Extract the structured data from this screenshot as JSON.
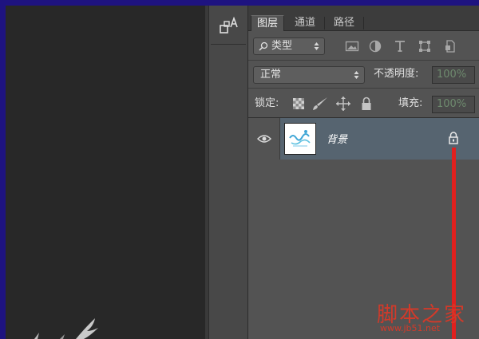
{
  "canvas": {},
  "toolstrip": {
    "icon": "character-panel-icon"
  },
  "panel": {
    "tabs": [
      {
        "label": "图层",
        "active": true
      },
      {
        "label": "通道",
        "active": false
      },
      {
        "label": "路径",
        "active": false
      }
    ],
    "filter": {
      "kind_label": "类型",
      "icons": [
        "image-filter-icon",
        "adjustment-filter-icon",
        "type-filter-icon",
        "shape-filter-icon",
        "smart-object-filter-icon"
      ]
    },
    "blend": {
      "mode": "正常",
      "opacity_label": "不透明度:",
      "opacity_value": "100%"
    },
    "lock": {
      "lock_label": "锁定:",
      "fill_label": "填充:",
      "fill_value": "100%"
    },
    "layers": [
      {
        "name": "背景",
        "visible": true,
        "locked": true
      }
    ]
  },
  "watermark": {
    "title": "脚本之家",
    "url": "www.jb51.net"
  },
  "colors": {
    "desktop_bg": "#1e1380",
    "panel_bg": "#535353",
    "selected_layer": "#566470",
    "annotation_red": "#e1201e"
  }
}
